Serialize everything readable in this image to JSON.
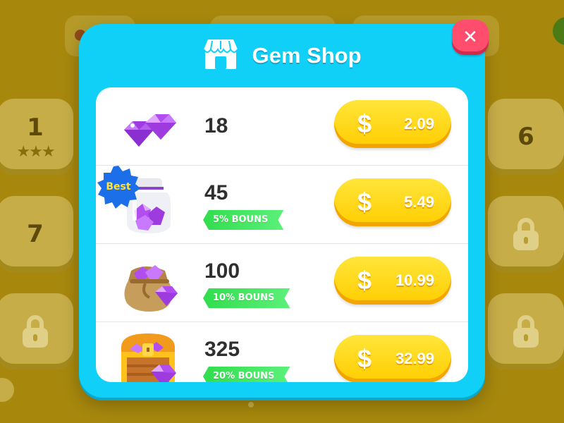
{
  "background": {
    "levels": [
      {
        "number": "1",
        "stars": "★★★"
      },
      {
        "number": "6",
        "stars": ""
      },
      {
        "number": "7",
        "stars": ""
      }
    ]
  },
  "shop": {
    "title": "Gem Shop",
    "title_icon": "store-icon",
    "close_icon": "close-icon",
    "close_glyph": "✕",
    "currency_symbol": "$",
    "best_badge": "Best",
    "items": [
      {
        "amount": "18",
        "bonus": "",
        "price": "2.09",
        "icon": "gem-pair-icon"
      },
      {
        "amount": "45",
        "bonus": "5% BOUNS",
        "price": "5.49",
        "icon": "gem-jar-icon"
      },
      {
        "amount": "100",
        "bonus": "10% BOUNS",
        "price": "10.99",
        "icon": "gem-sack-icon"
      },
      {
        "amount": "325",
        "bonus": "20% BOUNS",
        "price": "32.99",
        "icon": "treasure-chest-icon"
      }
    ]
  },
  "colors": {
    "modal": "#10d0f7",
    "buy_button": "#ffd400",
    "bonus_tag": "#31dd4d",
    "close_button": "#ff4d6d",
    "gem": "#b24ef0"
  }
}
